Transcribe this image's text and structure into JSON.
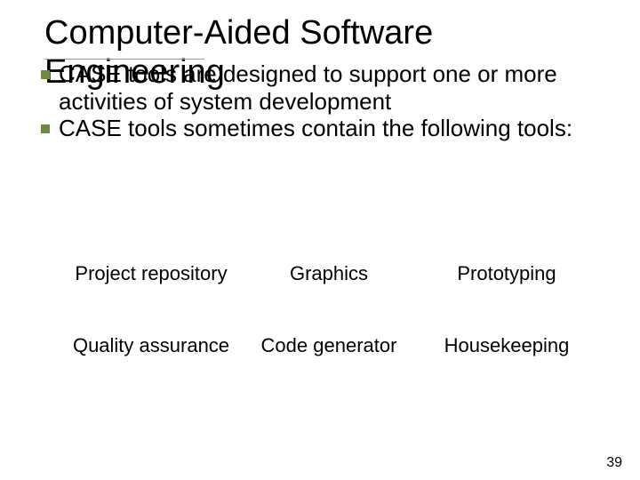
{
  "title_line1": "Computer-Aided Software",
  "title_line2": "Engineering",
  "bullets": [
    "CASE tools are designed to support one or more activities of system development",
    "CASE tools sometimes contain the following tools:"
  ],
  "tools": [
    "Project repository",
    "Graphics",
    "Prototyping",
    "Quality assurance",
    "Code generator",
    "Housekeeping"
  ],
  "page_number": "39"
}
